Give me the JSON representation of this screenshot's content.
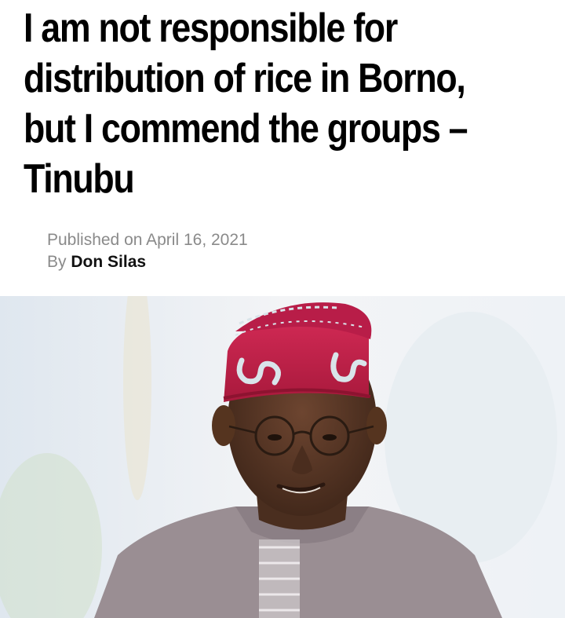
{
  "article": {
    "headline_lines": [
      "I am not responsible for",
      "distribution of rice in Borno,",
      "but I commend the groups –",
      "Tinubu"
    ],
    "published_label": "Published on",
    "published_date": "April 16, 2021",
    "by_label": "By",
    "author": "Don Silas"
  },
  "photo": {
    "subject": "portrait-photo",
    "colors": {
      "background": "#eef1f5",
      "cap": "#c4204a",
      "cap_pattern": "#d9e4ea",
      "skin": "#5a3826",
      "outfit": "#9a8e93"
    }
  }
}
